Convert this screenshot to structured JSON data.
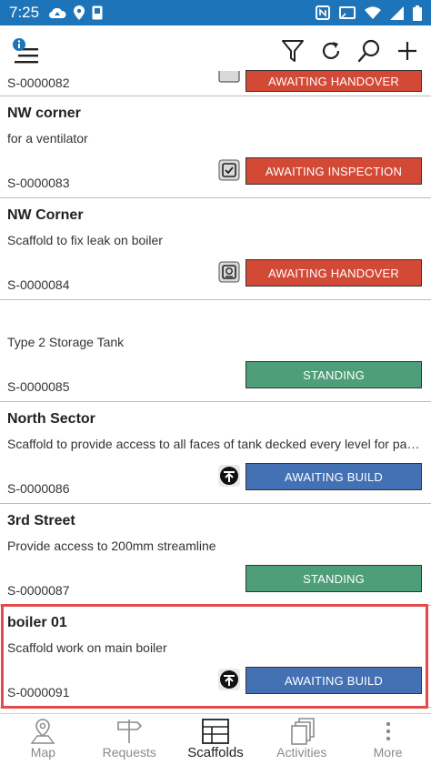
{
  "status_bar": {
    "time": "7:25"
  },
  "colors": {
    "status_bar_bg": "#1e74b8",
    "awaiting_red": "#d24a36",
    "standing_green": "#4e9e7a",
    "awaiting_build_blue": "#4371b4",
    "selection_border": "#e24b4b"
  },
  "toolbar": {
    "menu_icon": "menu-info-icon",
    "filter_icon": "filter-icon",
    "refresh_icon": "refresh-icon",
    "search_icon": "search-icon",
    "add_icon": "plus-icon"
  },
  "list": {
    "partial_item": {
      "code": "S-0000082",
      "status": "AWAITING HANDOVER"
    },
    "items": [
      {
        "title": "NW corner",
        "description": "for a ventilator",
        "code": "S-0000083",
        "status": "AWAITING INSPECTION",
        "badge_icon": "checkbox-icon"
      },
      {
        "title": "NW Corner",
        "description": "Scaffold to fix leak on boiler",
        "code": "S-0000084",
        "status": "AWAITING HANDOVER",
        "badge_icon": "handover-icon"
      },
      {
        "title": "",
        "description": "Type 2 Storage Tank",
        "code": "S-0000085",
        "status": "STANDING",
        "badge_icon": ""
      },
      {
        "title": "North Sector",
        "description": "Scaffold to provide access to all faces of tank decked every level for paint...",
        "code": "S-0000086",
        "status": "AWAITING BUILD",
        "badge_icon": "upload-arrow-icon"
      },
      {
        "title": "3rd Street",
        "description": "Provide access to 200mm streamline",
        "code": "S-0000087",
        "status": "STANDING",
        "badge_icon": ""
      },
      {
        "title": "boiler 01",
        "description": "Scaffold work on main boiler",
        "code": "S-0000091",
        "status": "AWAITING BUILD",
        "badge_icon": "upload-arrow-icon"
      }
    ]
  },
  "bottom_nav": {
    "map": "Map",
    "requests": "Requests",
    "scaffolds": "Scaffolds",
    "activities": "Activities",
    "more": "More",
    "active": "Scaffolds"
  }
}
